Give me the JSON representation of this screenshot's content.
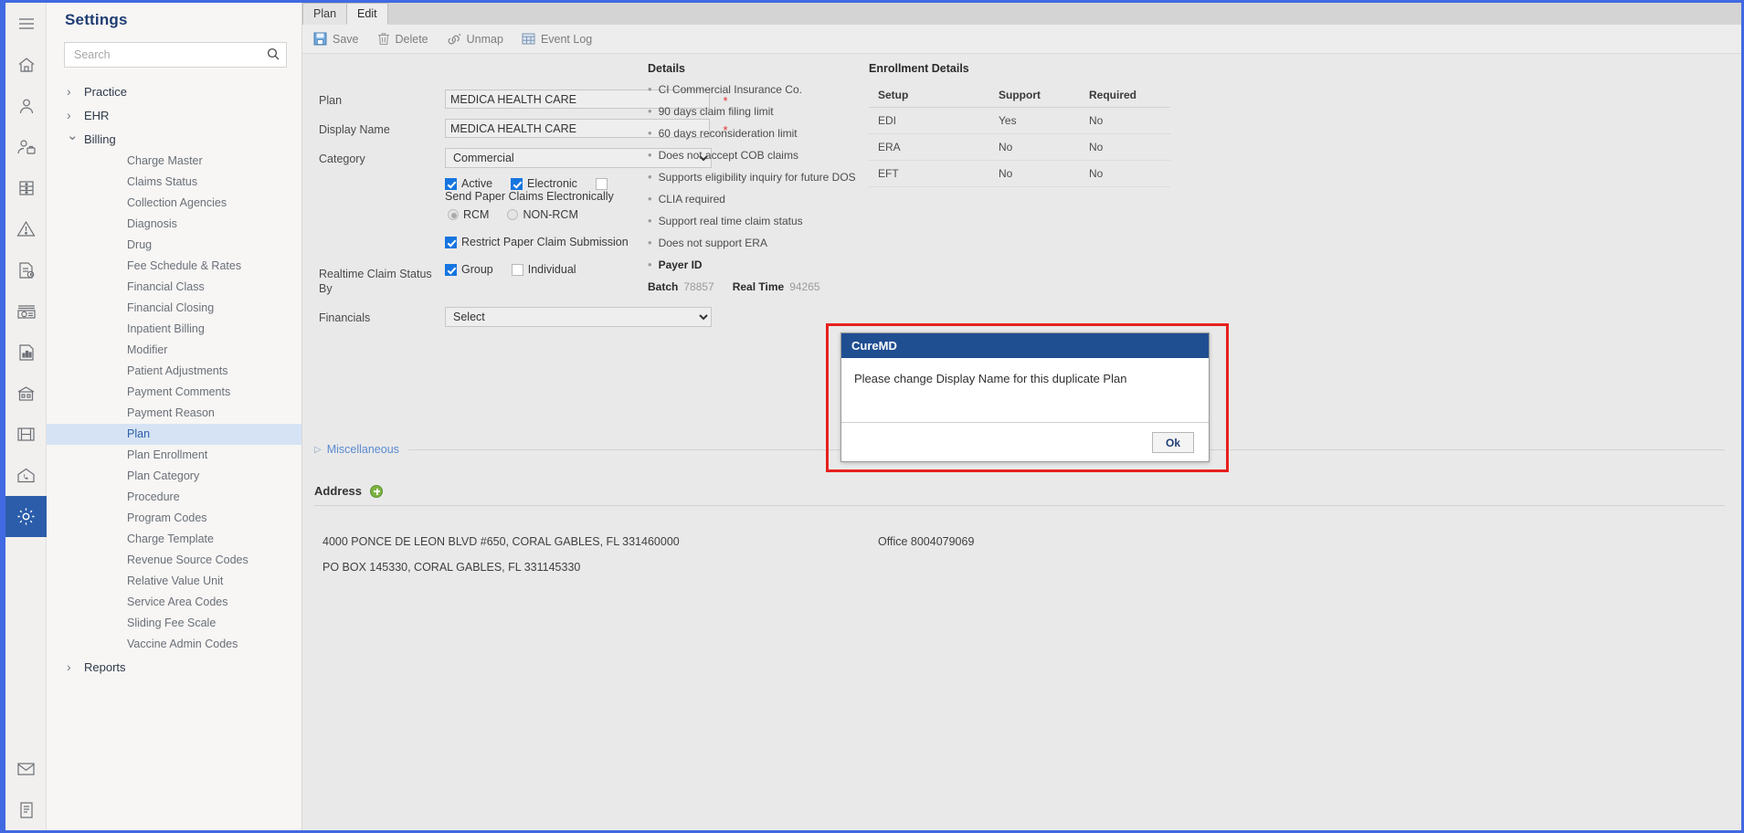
{
  "rail": {
    "icons": [
      {
        "name": "hamburger-menu-icon"
      },
      {
        "name": "home-icon"
      },
      {
        "name": "patient-icon"
      },
      {
        "name": "provider-icon"
      },
      {
        "name": "schedule-icon"
      },
      {
        "name": "alerts-icon"
      },
      {
        "name": "claims-icon"
      },
      {
        "name": "payments-icon"
      },
      {
        "name": "reports-icon"
      },
      {
        "name": "practice-icon"
      },
      {
        "name": "media-icon"
      },
      {
        "name": "telehealth-icon"
      },
      {
        "name": "settings-gear-icon"
      }
    ],
    "bottom_icons": [
      {
        "name": "mail-icon"
      },
      {
        "name": "notes-icon"
      }
    ]
  },
  "sidebar": {
    "title": "Settings",
    "search": {
      "placeholder": "Search",
      "value": "",
      "icon": "search-icon"
    },
    "groups": [
      {
        "label": "Practice",
        "expanded": false,
        "children": []
      },
      {
        "label": "EHR",
        "expanded": false,
        "children": []
      },
      {
        "label": "Billing",
        "expanded": true,
        "children": [
          "Charge Master",
          "Claims Status",
          "Collection Agencies",
          "Diagnosis",
          "Drug",
          "Fee Schedule & Rates",
          "Financial Class",
          "Financial Closing",
          "Inpatient Billing",
          "Modifier",
          "Patient Adjustments",
          "Payment Comments",
          "Payment Reason",
          "Plan",
          "Plan Enrollment",
          "Plan Category",
          "Procedure",
          "Program Codes",
          "Charge Template",
          "Revenue Source Codes",
          "Relative Value Unit",
          "Service Area Codes",
          "Sliding Fee Scale",
          "Vaccine Admin Codes"
        ]
      },
      {
        "label": "Reports",
        "expanded": false,
        "children": []
      }
    ],
    "selected_child": "Plan"
  },
  "tabs": [
    {
      "label": "Plan",
      "active": false
    },
    {
      "label": "Edit",
      "active": true
    }
  ],
  "toolbar": [
    {
      "label": "Save",
      "icon": "save-disk-icon"
    },
    {
      "label": "Delete",
      "icon": "trash-icon"
    },
    {
      "label": "Unmap",
      "icon": "link-broken-icon"
    },
    {
      "label": "Event Log",
      "icon": "grid-log-icon"
    }
  ],
  "form": {
    "plan": {
      "label": "Plan",
      "value": "MEDICA HEALTH CARE",
      "required": "*"
    },
    "display_name": {
      "label": "Display Name",
      "value": "MEDICA HEALTH CARE",
      "required": "*"
    },
    "category": {
      "label": "Category",
      "value": "Commercial",
      "options": [
        "Commercial"
      ]
    },
    "checkboxes_row1": [
      {
        "label": "Active",
        "checked": true
      },
      {
        "label": "Electronic",
        "checked": true
      },
      {
        "label": "Send Paper Claims Electronically",
        "checked": false
      }
    ],
    "radios": [
      {
        "label": "RCM",
        "checked": true
      },
      {
        "label": "NON-RCM",
        "checked": false
      }
    ],
    "restrict": {
      "label": "Restrict Paper Claim Submission",
      "checked": true
    },
    "realtime": {
      "label": "Realtime Claim Status By",
      "options": [
        {
          "label": "Group",
          "checked": true
        },
        {
          "label": "Individual",
          "checked": false
        }
      ]
    },
    "financials": {
      "label": "Financials",
      "value": "Select",
      "options": [
        "Select"
      ]
    }
  },
  "details": {
    "heading": "Details",
    "bullets": [
      {
        "text": "CI Commercial Insurance Co.",
        "bold": false
      },
      {
        "text": "90 days claim filing limit",
        "bold": false
      },
      {
        "text": "60 days reconsideration limit",
        "bold": false
      },
      {
        "text": "Does not accept COB claims",
        "bold": false
      },
      {
        "text": "Supports eligibility inquiry for future DOS",
        "bold": false
      },
      {
        "text": "CLIA required",
        "bold": false
      },
      {
        "text": "Support real time claim status",
        "bold": false
      },
      {
        "text": "Does not support ERA",
        "bold": false
      },
      {
        "text": "Payer ID",
        "bold": true
      }
    ],
    "payer_id": {
      "batch_label": "Batch",
      "batch_value": "78857",
      "realtime_label": "Real Time",
      "realtime_value": "94265"
    }
  },
  "enrollment": {
    "heading": "Enrollment Details",
    "columns": [
      "Setup",
      "Support",
      "Required"
    ],
    "rows": [
      [
        "EDI",
        "Yes",
        "No"
      ],
      [
        "ERA",
        "No",
        "No"
      ],
      [
        "EFT",
        "No",
        "No"
      ]
    ]
  },
  "miscellaneous": {
    "label": "Miscellaneous",
    "collapsed_icon": "triangle-right-icon"
  },
  "address": {
    "label": "Address",
    "add_icon": "add-circle-icon",
    "lines": [
      {
        "text": "4000 PONCE DE LEON BLVD #650, CORAL GABLES, FL 331460000",
        "office": "Office 8004079069"
      },
      {
        "text": "PO BOX 145330, CORAL GABLES, FL 331145330",
        "office": ""
      }
    ]
  },
  "modal": {
    "title": "CureMD",
    "message": "Please change Display Name for this duplicate Plan",
    "ok_label": "Ok"
  },
  "colors": {
    "accent_blue": "#1f4e91",
    "selected_nav": "#d6e3f5",
    "highlight_red": "#e8201f",
    "checkbox_blue": "#1675e0"
  }
}
